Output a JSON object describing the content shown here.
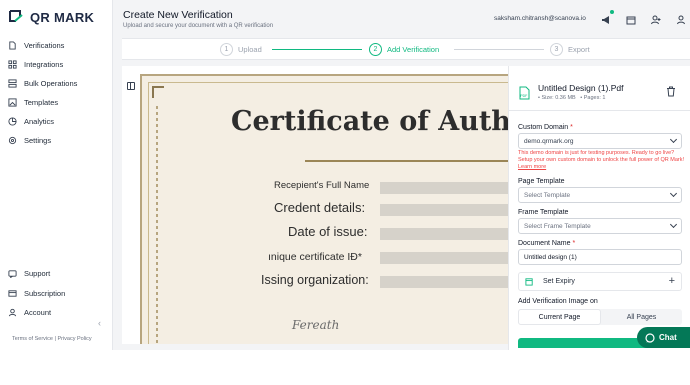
{
  "brand": {
    "name": "QR MARK",
    "accent": "#10b981",
    "logo_color": "#1f2a44"
  },
  "sidebar": {
    "items": [
      {
        "label": "Verifications",
        "icon": "file-icon"
      },
      {
        "label": "Integrations",
        "icon": "grid-icon"
      },
      {
        "label": "Bulk Operations",
        "icon": "layers-icon"
      },
      {
        "label": "Templates",
        "icon": "image-icon"
      },
      {
        "label": "Analytics",
        "icon": "chart-icon"
      },
      {
        "label": "Settings",
        "icon": "gear-icon"
      }
    ],
    "bottom_items": [
      {
        "label": "Support",
        "icon": "support-icon"
      },
      {
        "label": "Subscription",
        "icon": "card-icon"
      },
      {
        "label": "Account",
        "icon": "user-icon"
      }
    ],
    "footer": "Terms of Service | Privacy Policy"
  },
  "header": {
    "title": "Create New Verification",
    "subtitle": "Upload and secure your document with a QR verification",
    "user_email": "saksham.chitransh@scanova.io"
  },
  "stepper": {
    "steps": [
      {
        "num": "1",
        "label": "Upload"
      },
      {
        "num": "2",
        "label": "Add Verification"
      },
      {
        "num": "3",
        "label": "Export"
      }
    ]
  },
  "certificate": {
    "title": "Certificate of Auth",
    "fields": [
      "Recepient's Full Name",
      "Credent details:",
      "Date of issue:",
      "ınique certificate IĐ*",
      "Issing organization:"
    ],
    "signature": "Fereath"
  },
  "panel": {
    "file_name": "Untitled Design (1).Pdf",
    "file_type": "PDF",
    "file_size": "•  Size: 0.36 MB",
    "file_pages": "•  Pages: 1",
    "custom_domain_label": "Custom Domain",
    "custom_domain_value": "demo.qrmark.org",
    "warning_text": "This demo domain is just for testing purposes. Ready to go live? Setup your own custom domain to unlock the full power of QR Mark!",
    "warning_link": "Learn more",
    "page_template_label": "Page Template",
    "page_template_placeholder": "Select Template",
    "frame_template_label": "Frame Template",
    "frame_template_placeholder": "Select Frame Template",
    "document_name_label": "Document Name",
    "document_name_value": "Untitled design (1)",
    "expiry_label": "Set Expiry",
    "verification_image_label": "Add Verification Image on",
    "toggle_current": "Current Page",
    "toggle_all": "All Pages"
  },
  "chat": {
    "label": "Chat"
  }
}
